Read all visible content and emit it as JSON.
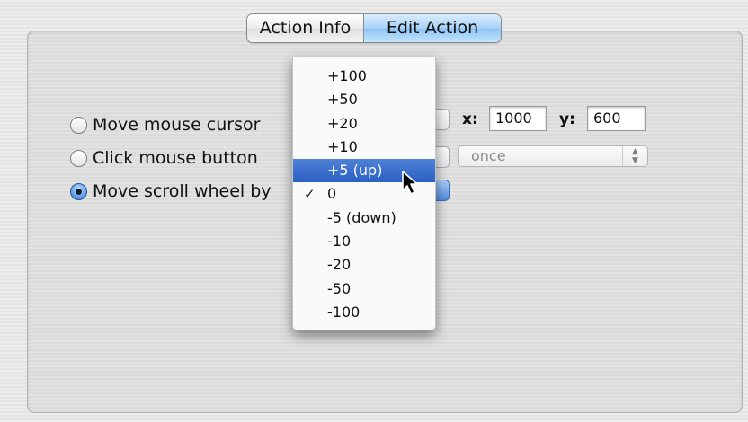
{
  "tabs": [
    {
      "label": "Action Info",
      "selected": false
    },
    {
      "label": "Edit Action",
      "selected": true
    }
  ],
  "options": [
    {
      "label": "Move mouse cursor",
      "selected": false
    },
    {
      "label": "Click mouse button",
      "selected": false
    },
    {
      "label": "Move scroll wheel by",
      "selected": true
    }
  ],
  "move": {
    "x_label": "x:",
    "x_value": "1000",
    "y_label": "y:",
    "y_value": "600"
  },
  "click": {
    "repeat_value": "once"
  },
  "scroll_menu": {
    "items": [
      "+100",
      "+50",
      "+20",
      "+10",
      "+5 (up)",
      "0",
      "-5 (down)",
      "-10",
      "-20",
      "-50",
      "-100"
    ],
    "highlighted": "+5 (up)",
    "checked": "0",
    "check_glyph": "✓"
  },
  "colors": {
    "accent_blue": "#2a5fc4",
    "tab_active": "#a9d3f8"
  }
}
